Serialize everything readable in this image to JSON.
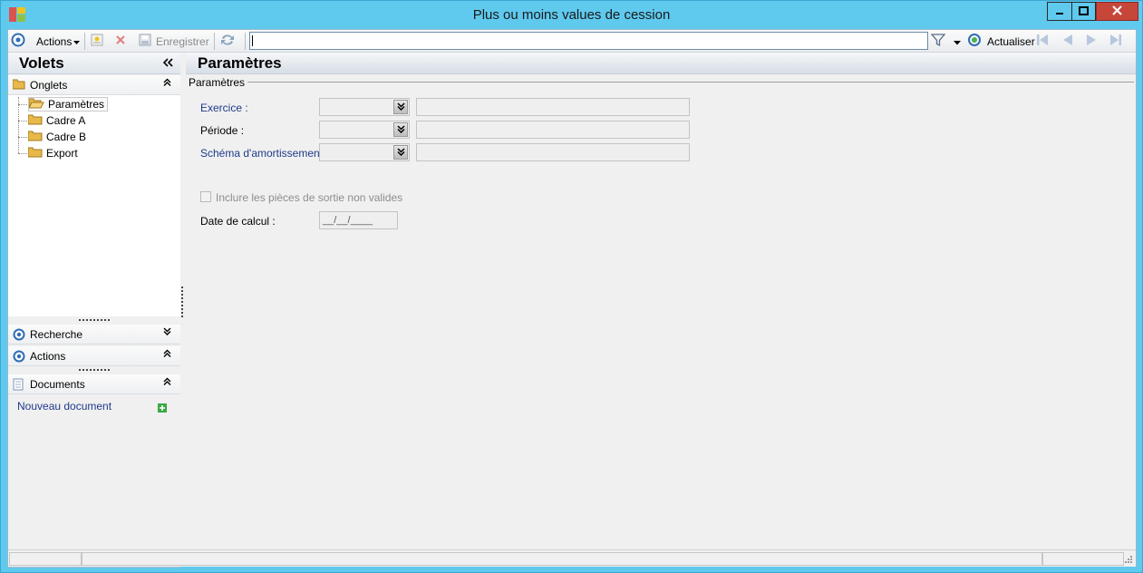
{
  "window": {
    "title": "Plus ou moins values de cession"
  },
  "toolbar": {
    "actions_label": "Actions",
    "save_label": "Enregistrer",
    "search_value": "",
    "refresh_label": "Actualiser"
  },
  "left_panel": {
    "title": "Volets",
    "onglets": {
      "label": "Onglets",
      "items": [
        {
          "label": "Paramètres",
          "selected": true
        },
        {
          "label": "Cadre A",
          "selected": false
        },
        {
          "label": "Cadre B",
          "selected": false
        },
        {
          "label": "Export",
          "selected": false
        }
      ]
    },
    "recherche_label": "Recherche",
    "actions_label": "Actions",
    "documents": {
      "label": "Documents",
      "new_document_label": "Nouveau document"
    }
  },
  "main": {
    "title": "Paramètres",
    "group_label": "Paramètres",
    "fields": {
      "exercice_label": "Exercice :",
      "periode_label": "Période :",
      "schema_label": "Schéma d'amortissement :",
      "include_label": "Inclure les pièces de sortie non valides",
      "date_label": "Date de calcul :",
      "date_value": "__/__/____"
    }
  },
  "colors": {
    "title_bar": "#5fc9ee",
    "close_button": "#c7463a",
    "link_blue": "#1f3a8a",
    "panel_bg": "#f0f0f0"
  }
}
